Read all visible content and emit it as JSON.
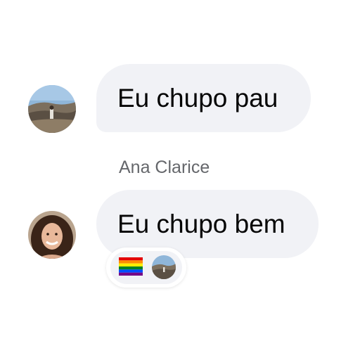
{
  "messages": [
    {
      "avatar": "landscape-avatar-icon",
      "text": "Eu chupo pau"
    },
    {
      "sender": "Ana Clarice",
      "avatar": "woman-portrait-avatar-icon",
      "text": "Eu chupo bem",
      "reactions": [
        {
          "icon": "rainbow-flag-icon"
        },
        {
          "icon": "landscape-avatar-icon"
        }
      ]
    }
  ],
  "colors": {
    "bubble_background": "#f1f2f6",
    "message_text": "#050505",
    "sender_name_text": "#65676b"
  }
}
